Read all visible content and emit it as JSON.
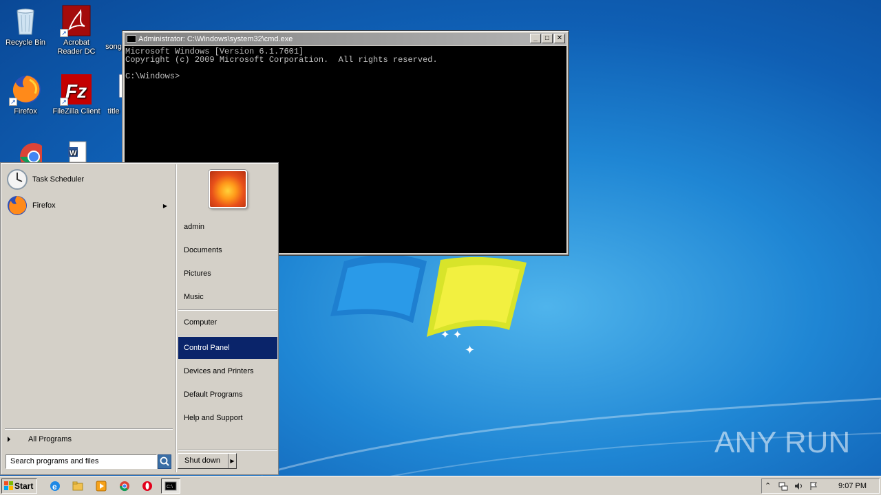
{
  "desktop": {
    "icons": [
      {
        "label": "Recycle Bin"
      },
      {
        "label": "Acrobat Reader DC"
      },
      {
        "label": "song"
      },
      {
        "label": "Firefox"
      },
      {
        "label": "FileZilla Client"
      },
      {
        "label": "title"
      }
    ],
    "watermark": "ANY RUN"
  },
  "cmd": {
    "title": "Administrator: C:\\Windows\\system32\\cmd.exe",
    "lines": [
      "Microsoft Windows [Version 6.1.7601]",
      "Copyright (c) 2009 Microsoft Corporation.  All rights reserved.",
      "",
      "C:\\Windows>"
    ]
  },
  "start_menu": {
    "programs": [
      {
        "label": "Task Scheduler"
      },
      {
        "label": "Firefox"
      }
    ],
    "all_programs": "All Programs",
    "search_placeholder": "Search programs and files",
    "right_links": [
      {
        "label": "admin"
      },
      {
        "label": "Documents"
      },
      {
        "label": "Pictures"
      },
      {
        "label": "Music"
      },
      {
        "label": "Computer"
      },
      {
        "label": "Control Panel"
      },
      {
        "label": "Devices and Printers"
      },
      {
        "label": "Default Programs"
      },
      {
        "label": "Help and Support"
      }
    ],
    "shutdown": "Shut down"
  },
  "taskbar": {
    "start": "Start",
    "clock": "9:07 PM"
  }
}
